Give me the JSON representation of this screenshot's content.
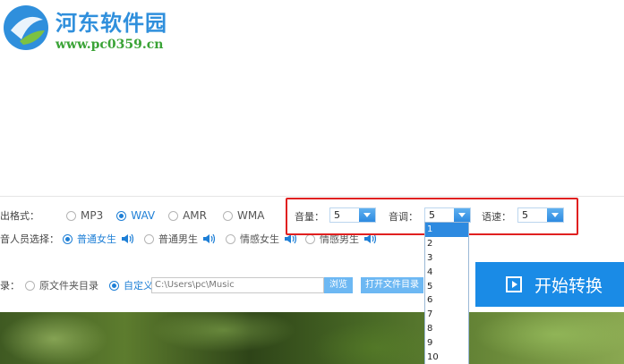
{
  "watermark": {
    "title": "河东软件园",
    "url": "www.pc0359.cn"
  },
  "format": {
    "label": "出格式：",
    "options": [
      {
        "label": "MP3",
        "selected": false
      },
      {
        "label": "WAV",
        "selected": true
      },
      {
        "label": "AMR",
        "selected": false
      },
      {
        "label": "WMA",
        "selected": false
      }
    ]
  },
  "voice": {
    "label": "音人员选择：",
    "options": [
      {
        "label": "普通女生",
        "selected": true
      },
      {
        "label": "普通男生",
        "selected": false
      },
      {
        "label": "情感女生",
        "selected": false
      },
      {
        "label": "情感男生",
        "selected": false
      }
    ]
  },
  "settings": {
    "volume": {
      "label": "音量：",
      "value": "5"
    },
    "pitch": {
      "label": "音调：",
      "value": "5"
    },
    "speed": {
      "label": "语速：",
      "value": "5"
    }
  },
  "pitch_dropdown": {
    "options": [
      "1",
      "2",
      "3",
      "4",
      "5",
      "6",
      "7",
      "8",
      "9",
      "10"
    ],
    "highlighted": "1"
  },
  "output": {
    "label": "录：",
    "original_folder": "原文件夹目录",
    "custom": "自定义：",
    "path": "C:\\Users\\pc\\Music",
    "browse": "浏览",
    "open_folder": "打开文件目录"
  },
  "start_button": {
    "label": "开始转换"
  },
  "colors": {
    "accent": "#1a8be6",
    "highlight_box": "#e02020",
    "watermark_title": "#2f8fdc",
    "watermark_url": "#3aa336"
  }
}
